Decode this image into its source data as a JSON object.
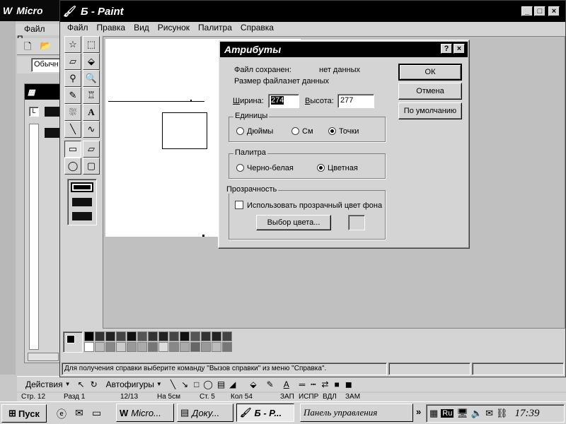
{
  "word_window": {
    "title": "Micro",
    "menu_file": "Файл",
    "menu_edit_partial": "П",
    "style_box": "Обычн",
    "status_bar": [
      "Стр. 12",
      "Разд 1",
      "12/13",
      "На 5см",
      "Ст. 5",
      "Кол 54",
      "ЗАП",
      "ИСПР",
      "ВДЛ",
      "ЗАМ"
    ],
    "drawing_bar": {
      "actions": "Действия",
      "autoshapes": "Автофигуры"
    }
  },
  "paint_window": {
    "title": "Б - Paint",
    "menu": [
      "Файл",
      "Правка",
      "Вид",
      "Рисунок",
      "Палитра",
      "Справка"
    ],
    "status_text": "Для получения справки выберите команду \"Вызов справки\" из меню \"Справка\".",
    "tools": [
      "free-select",
      "select",
      "eraser",
      "fill",
      "color-picker",
      "magnifier",
      "pencil",
      "brush",
      "airbrush",
      "text",
      "line",
      "curve",
      "rectangle",
      "polygon",
      "ellipse",
      "rounded-rectangle"
    ],
    "tool_glyphs": [
      "☆",
      "⬚",
      "▱",
      "⬙",
      "✎",
      "🔍",
      "✏",
      "🖌",
      "⛆",
      "A",
      "╲",
      "∿",
      "▭",
      "▱",
      "◯",
      "▢"
    ]
  },
  "attributes_dialog": {
    "title": "Атрибуты",
    "help_button": "?",
    "close_button": "×",
    "file_saved_label": "Файл сохранен:",
    "file_saved_value": "нет данных",
    "file_size_label": "Размер файла:",
    "file_size_value": "нет данных",
    "width_label": "Ширина:",
    "width_value": "274",
    "height_label": "Высота:",
    "height_value": "277",
    "units_group": "Единицы",
    "units": [
      {
        "label": "Дюймы",
        "selected": false
      },
      {
        "label": "См",
        "selected": false
      },
      {
        "label": "Точки",
        "selected": true
      }
    ],
    "palette_group": "Палитра",
    "palette": [
      {
        "label": "Черно-белая",
        "selected": false
      },
      {
        "label": "Цветная",
        "selected": true
      }
    ],
    "transparency_group": "Прозрачность",
    "transparency_checkbox": "Использовать прозрачный цвет фона",
    "transparency_checked": false,
    "color_button": "Выбор цвета...",
    "ok_button": "ОК",
    "cancel_button": "Отмена",
    "default_button": "По умолчанию"
  },
  "taskbar": {
    "start": "Пуск",
    "buttons": [
      "Micro...",
      "Доку...",
      "Б - Р..."
    ],
    "control_panel": "Панель управления",
    "lang": "Ru",
    "clock": "17:39"
  }
}
